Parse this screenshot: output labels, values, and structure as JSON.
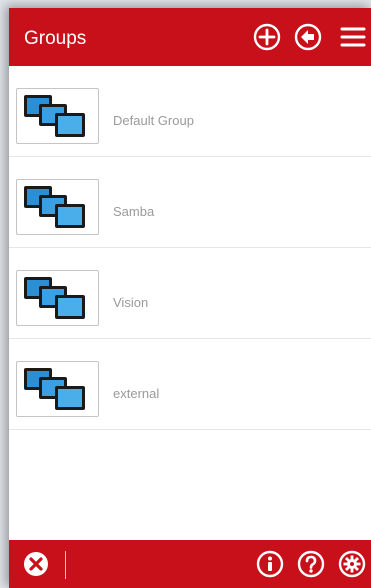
{
  "header": {
    "title": "Groups",
    "buttons": [
      {
        "icon": "plus-circle-icon"
      },
      {
        "icon": "back-arrow-circle-icon"
      },
      {
        "icon": "menu-icon"
      }
    ]
  },
  "groups": [
    {
      "name": "Default Group",
      "icon": "device-group-icon"
    },
    {
      "name": "Samba",
      "icon": "device-group-icon"
    },
    {
      "name": "Vision",
      "icon": "device-group-icon"
    },
    {
      "name": "external",
      "icon": "device-group-icon"
    }
  ],
  "footer": {
    "left_button": {
      "icon": "close-circle-icon"
    },
    "right_buttons": [
      {
        "icon": "info-circle-icon"
      },
      {
        "icon": "help-circle-icon"
      },
      {
        "icon": "settings-gear-icon"
      }
    ]
  },
  "colors": {
    "brand_red": "#c8101a",
    "label_gray": "#9a9a9a"
  }
}
